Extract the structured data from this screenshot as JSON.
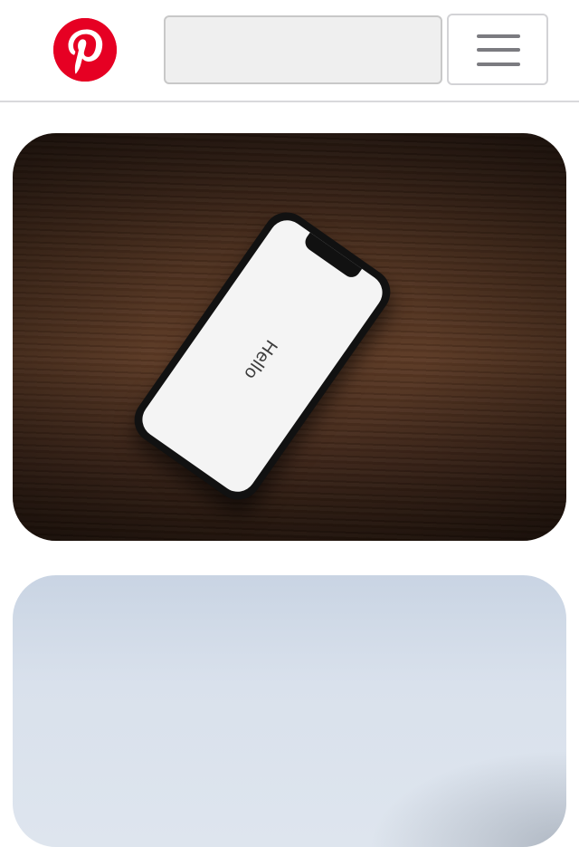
{
  "header": {
    "logo_icon": "pinterest-logo-icon",
    "logo_color": "#e60023",
    "search": {
      "value": "",
      "placeholder": ""
    },
    "menu_icon": "hamburger-menu-icon"
  },
  "feed": {
    "pins": [
      {
        "image": "phone-on-wooden-desk",
        "screen_text": "Hello"
      },
      {
        "image": "pale-blue-sky"
      }
    ]
  }
}
